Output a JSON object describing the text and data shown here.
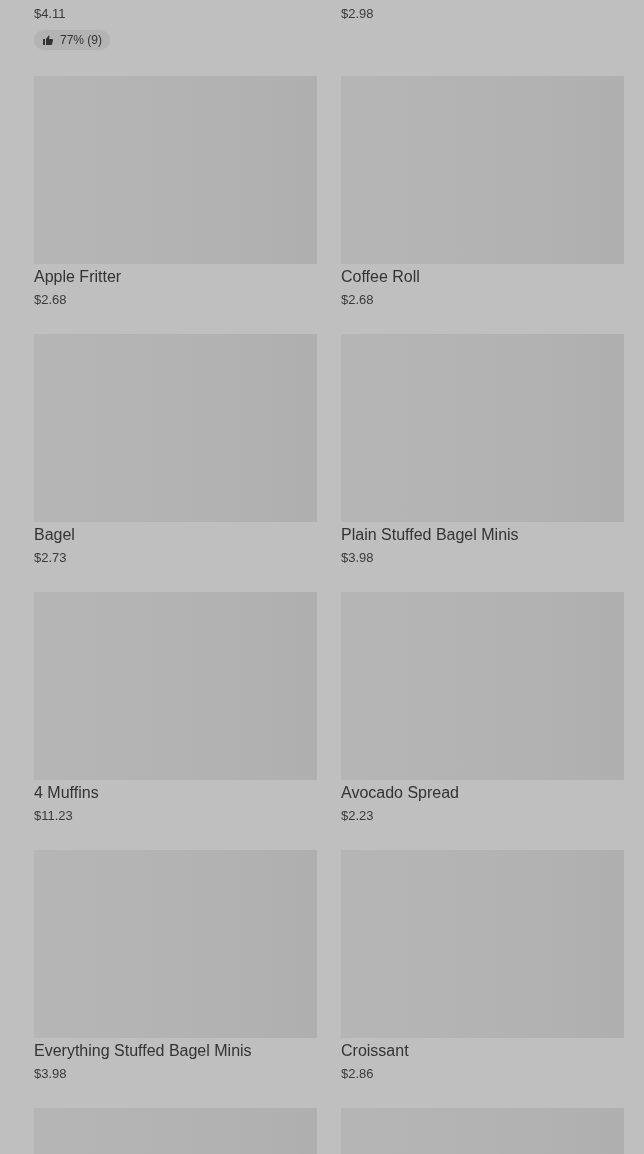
{
  "items": [
    {
      "kind": "summary",
      "price": "$4.11",
      "rating": "77% (9)"
    },
    {
      "kind": "summary",
      "price": "$2.98"
    },
    {
      "kind": "card",
      "name": "Apple Fritter",
      "price": "$2.68"
    },
    {
      "kind": "card",
      "name": "Coffee Roll",
      "price": "$2.68"
    },
    {
      "kind": "card",
      "name": "Bagel",
      "price": "$2.73"
    },
    {
      "kind": "card",
      "name": "Plain Stuffed Bagel Minis",
      "price": "$3.98"
    },
    {
      "kind": "card",
      "name": "4 Muffins",
      "price": "$11.23"
    },
    {
      "kind": "card",
      "name": "Avocado Spread",
      "price": "$2.23"
    },
    {
      "kind": "card",
      "name": "Everything Stuffed Bagel Minis",
      "price": "$3.98"
    },
    {
      "kind": "card",
      "name": "Croissant",
      "price": "$2.86"
    },
    {
      "kind": "card"
    },
    {
      "kind": "card"
    }
  ]
}
